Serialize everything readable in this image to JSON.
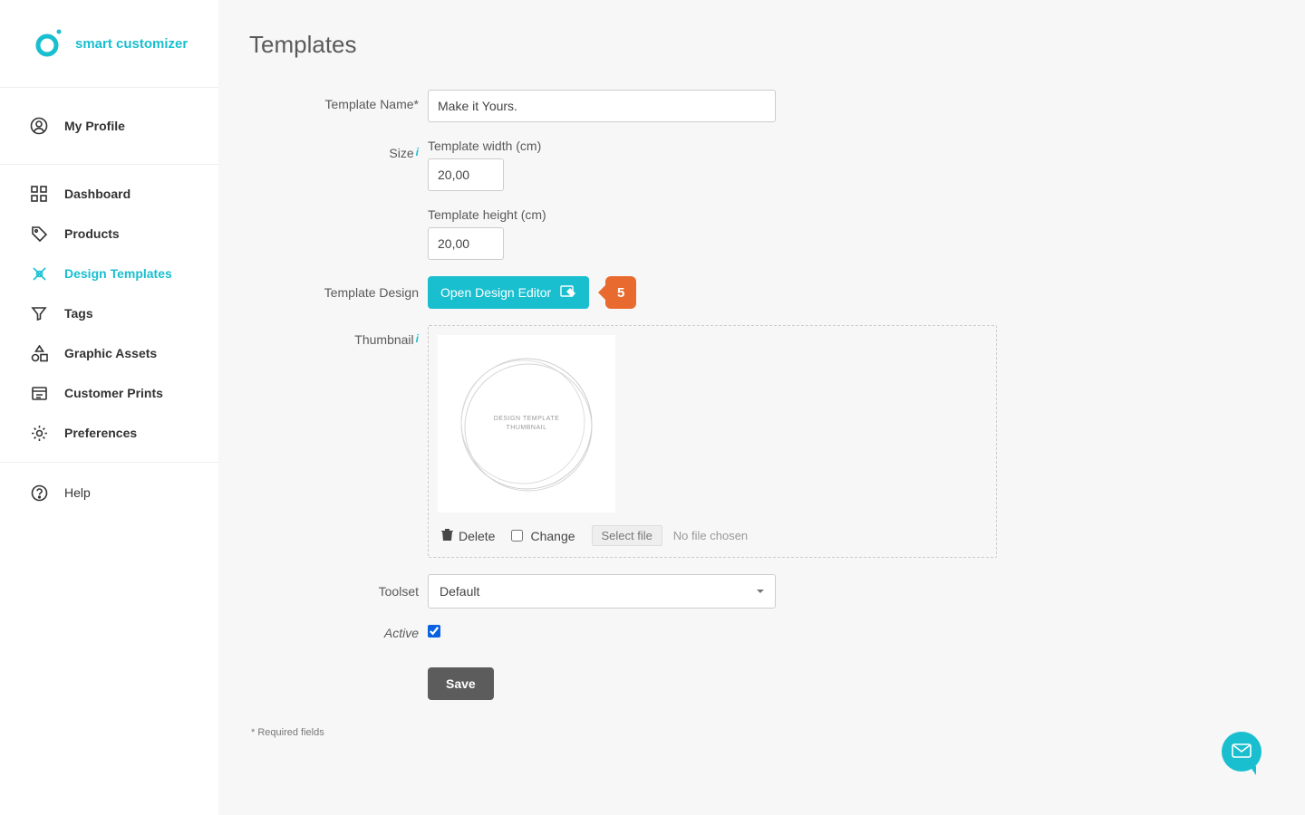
{
  "brand": {
    "name": "smart customizer"
  },
  "sidebar": {
    "profile": {
      "label": "My Profile"
    },
    "items": [
      {
        "label": "Dashboard"
      },
      {
        "label": "Products"
      },
      {
        "label": "Design Templates"
      },
      {
        "label": "Tags"
      },
      {
        "label": "Graphic Assets"
      },
      {
        "label": "Customer Prints"
      },
      {
        "label": "Preferences"
      }
    ],
    "help": {
      "label": "Help"
    }
  },
  "page": {
    "title": "Templates",
    "required_note": "* Required fields"
  },
  "form": {
    "template_name": {
      "label": "Template Name*",
      "value": "Make it Yours."
    },
    "size": {
      "label": "Size",
      "width_label": "Template width (cm)",
      "width_value": "20,00",
      "height_label": "Template height (cm)",
      "height_value": "20,00"
    },
    "template_design": {
      "label": "Template Design",
      "button": "Open Design Editor",
      "callout_number": "5"
    },
    "thumbnail": {
      "label": "Thumbnail",
      "preview_text_line1": "DESIGN TEMPLATE",
      "preview_text_line2": "THUMBNAIL",
      "delete": "Delete",
      "change": "Change",
      "select_file": "Select file",
      "no_file": "No file chosen"
    },
    "toolset": {
      "label": "Toolset",
      "value": "Default"
    },
    "active": {
      "label": "Active",
      "checked": true
    },
    "save": "Save"
  },
  "colors": {
    "accent": "#19bfcf",
    "callout": "#e96a2e"
  }
}
